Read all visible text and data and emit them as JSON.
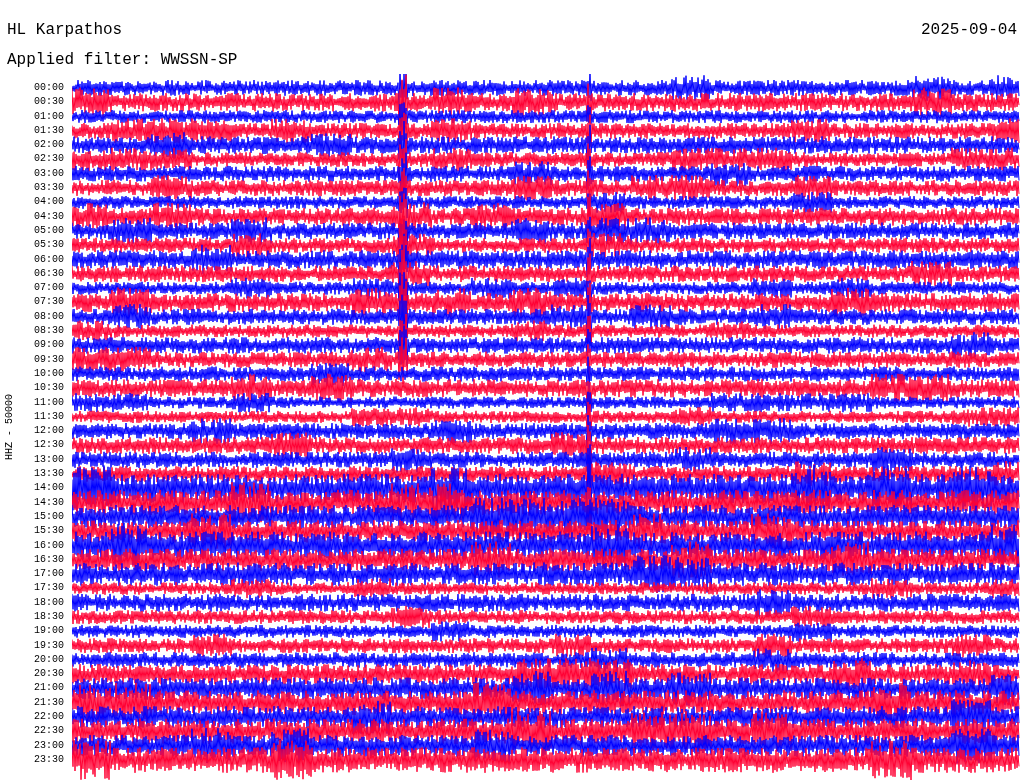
{
  "header": {
    "station": "HL Karpathos",
    "date": "2025-09-04",
    "filter": "Applied filter: WWSSN-SP"
  },
  "axis_label": "HHZ - 50000",
  "traces": [
    {
      "time": "00:00",
      "color": "#0000ff"
    },
    {
      "time": "00:30",
      "color": "#ff0033"
    },
    {
      "time": "01:00",
      "color": "#0000ff"
    },
    {
      "time": "01:30",
      "color": "#ff0033"
    },
    {
      "time": "02:00",
      "color": "#0000ff"
    },
    {
      "time": "02:30",
      "color": "#ff0033"
    },
    {
      "time": "03:00",
      "color": "#0000ff"
    },
    {
      "time": "03:30",
      "color": "#ff0033"
    },
    {
      "time": "04:00",
      "color": "#0000ff"
    },
    {
      "time": "04:30",
      "color": "#ff0033"
    },
    {
      "time": "05:00",
      "color": "#0000ff"
    },
    {
      "time": "05:30",
      "color": "#ff0033"
    },
    {
      "time": "06:00",
      "color": "#0000ff"
    },
    {
      "time": "06:30",
      "color": "#ff0033"
    },
    {
      "time": "07:00",
      "color": "#0000ff"
    },
    {
      "time": "07:30",
      "color": "#ff0033"
    },
    {
      "time": "08:00",
      "color": "#0000ff"
    },
    {
      "time": "08:30",
      "color": "#ff0033"
    },
    {
      "time": "09:00",
      "color": "#0000ff"
    },
    {
      "time": "09:30",
      "color": "#ff0033"
    },
    {
      "time": "10:00",
      "color": "#0000ff"
    },
    {
      "time": "10:30",
      "color": "#ff0033"
    },
    {
      "time": "11:00",
      "color": "#0000ff"
    },
    {
      "time": "11:30",
      "color": "#ff0033"
    },
    {
      "time": "12:00",
      "color": "#0000ff"
    },
    {
      "time": "12:30",
      "color": "#ff0033"
    },
    {
      "time": "13:00",
      "color": "#0000ff"
    },
    {
      "time": "13:30",
      "color": "#ff0033"
    },
    {
      "time": "14:00",
      "color": "#0000ff"
    },
    {
      "time": "14:30",
      "color": "#ff0033"
    },
    {
      "time": "15:00",
      "color": "#0000ff"
    },
    {
      "time": "15:30",
      "color": "#ff0033"
    },
    {
      "time": "16:00",
      "color": "#0000ff"
    },
    {
      "time": "16:30",
      "color": "#ff0033"
    },
    {
      "time": "17:00",
      "color": "#0000ff"
    },
    {
      "time": "17:30",
      "color": "#ff0033"
    },
    {
      "time": "18:00",
      "color": "#0000ff"
    },
    {
      "time": "18:30",
      "color": "#ff0033"
    },
    {
      "time": "19:00",
      "color": "#0000ff"
    },
    {
      "time": "19:30",
      "color": "#ff0033"
    },
    {
      "time": "20:00",
      "color": "#0000ff"
    },
    {
      "time": "20:30",
      "color": "#ff0033"
    },
    {
      "time": "21:00",
      "color": "#0000ff"
    },
    {
      "time": "21:30",
      "color": "#ff0033"
    },
    {
      "time": "22:00",
      "color": "#0000ff"
    },
    {
      "time": "22:30",
      "color": "#ff0033"
    },
    {
      "time": "23:00",
      "color": "#0000ff"
    },
    {
      "time": "23:30",
      "color": "#ff0033"
    }
  ]
}
